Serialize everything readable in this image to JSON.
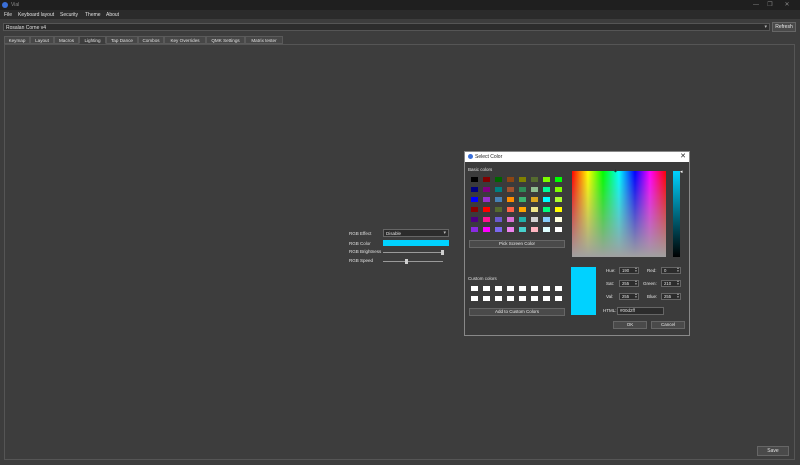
{
  "window": {
    "title": "Vial",
    "controls": [
      "—",
      "❐",
      "✕"
    ]
  },
  "menu": [
    "File",
    "Keyboard layout",
    "Security",
    "Theme",
    "About"
  ],
  "keyboard": {
    "selected": "Rosalan Corne v4",
    "refresh_label": "Refresh"
  },
  "tabs": [
    "Keymap",
    "Layout",
    "Macros",
    "Lighting",
    "Tap Dance",
    "Combos",
    "Key Overrides",
    "QMK Settings",
    "Matrix tester"
  ],
  "active_tab": "Lighting",
  "lighting": {
    "effect_label": "RGB Effect",
    "effect_value": "Disable",
    "color_label": "RGB Color",
    "color_value": "#00d2ff",
    "brightness_label": "RGB Brightness",
    "brightness_level": 1.0,
    "speed_label": "RGB Speed",
    "speed_level": 0.38
  },
  "save_label": "Save",
  "dialog": {
    "title": "Select Color",
    "close": "✕",
    "basic_colors_label": "Basic colors",
    "basic_colors": [
      "#000000",
      "#800000",
      "#006400",
      "#8b4513",
      "#808000",
      "#556b2f",
      "#7cfc00",
      "#00ff00",
      "#000080",
      "#800080",
      "#008080",
      "#a0522d",
      "#2e8b57",
      "#8fbc8f",
      "#00fa9a",
      "#7fff00",
      "#0000ff",
      "#9932cc",
      "#4682b4",
      "#ff8c00",
      "#3cb371",
      "#daa520",
      "#00ffff",
      "#adff2f",
      "#8b0000",
      "#ff0000",
      "#556b2f",
      "#ff6347",
      "#ffa500",
      "#f0e68c",
      "#00ff7f",
      "#ffff00",
      "#4b0082",
      "#ff1493",
      "#6a5acd",
      "#da70d6",
      "#20b2aa",
      "#d3d3d3",
      "#87cefa",
      "#ffffe0",
      "#8a2be2",
      "#ff00ff",
      "#7b68ee",
      "#ee82ee",
      "#48d1cc",
      "#ffb6c1",
      "#e0ffff",
      "#ffffff"
    ],
    "pick_screen_label": "Pick Screen Color",
    "custom_colors_label": "Custom colors",
    "add_custom_label": "Add to Custom Colors",
    "fields": {
      "hue_label": "Hue:",
      "hue": "190",
      "sat_label": "Sat:",
      "sat": "255",
      "val_label": "Val:",
      "val": "255",
      "red_label": "Red:",
      "red": "0",
      "green_label": "Green:",
      "green": "210",
      "blue_label": "Blue:",
      "blue": "255",
      "html_label": "HTML:",
      "html": "#00d2ff"
    },
    "ok_label": "OK",
    "cancel_label": "Cancel"
  }
}
